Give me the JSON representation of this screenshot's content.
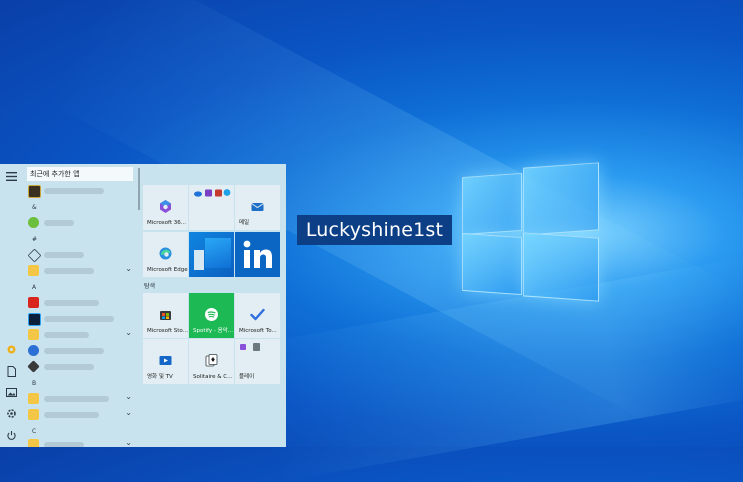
{
  "overlay": {
    "caption": "Luckyshine1st"
  },
  "start_menu": {
    "recent_header": "최근에 추가한 앱",
    "letters": [
      "&",
      "#",
      "A",
      "B",
      "C"
    ],
    "rail_icons": [
      "hamburger-icon",
      "app-settings-icon",
      "document-icon",
      "pictures-icon",
      "settings-icon",
      "power-icon"
    ],
    "tiles": [
      {
        "label": "Microsoft 36...",
        "icon": "microsoft-365-icon"
      },
      {
        "label": "",
        "icon": "office-apps-group-icon"
      },
      {
        "label": "메일",
        "icon": "mail-icon"
      },
      {
        "label": "Microsoft Edge",
        "icon": "edge-icon"
      },
      {
        "label": "",
        "icon": "photos-live-tile"
      },
      {
        "label": "",
        "icon": "linkedin-icon"
      },
      {
        "label": "Microsoft Sto...",
        "icon": "store-icon"
      },
      {
        "label": "Spotify - 음악...",
        "icon": "spotify-icon"
      },
      {
        "label": "Microsoft To...",
        "icon": "todo-icon"
      },
      {
        "label": "영화 및 TV",
        "icon": "movies-tv-icon"
      },
      {
        "label": "Solitaire & C...",
        "icon": "solitaire-icon"
      },
      {
        "label": "플레이",
        "icon": "play-folder-icon"
      }
    ],
    "group_label": "탐색",
    "colors": {
      "menu_bg": "#c9e3ee",
      "spotify": "#1db954",
      "linkedin": "#0a66c2",
      "edge_blue": "#2b8fe0"
    }
  }
}
